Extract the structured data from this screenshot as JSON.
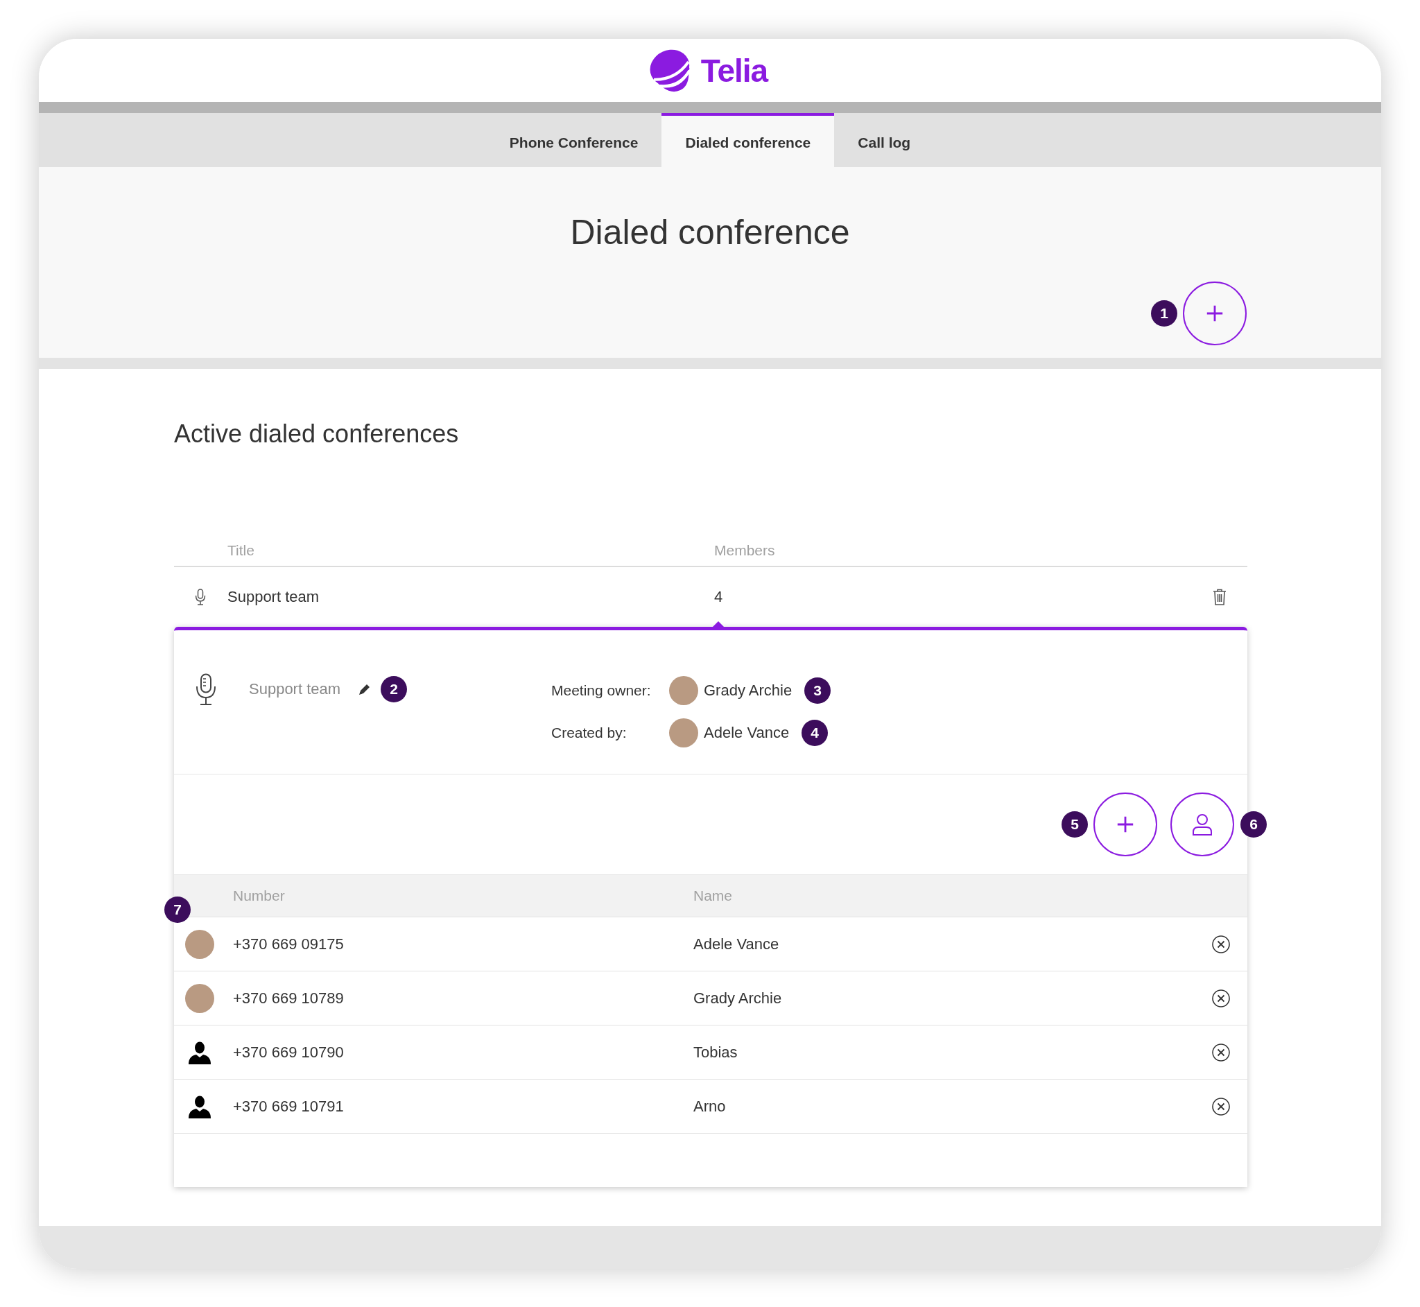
{
  "header": {
    "logo_text": "Telia"
  },
  "tabs": [
    {
      "label": "Phone Conference",
      "selected": false
    },
    {
      "label": "Dialed conference",
      "selected": true
    },
    {
      "label": "Call log",
      "selected": false
    }
  ],
  "page_title": "Dialed conference",
  "create_button": {
    "badge": "1"
  },
  "section_title": "Active dialed conferences",
  "conferences_table": {
    "columns": [
      "Title",
      "Members"
    ],
    "rows": [
      {
        "title": "Support team",
        "members": "4",
        "expanded": true
      }
    ]
  },
  "details": {
    "title": "Support team",
    "title_badge": "2",
    "meeting_owner": {
      "label": "Meeting owner:",
      "name": "Grady Archie",
      "badge": "3"
    },
    "created_by": {
      "label": "Created by:",
      "name": "Adele Vance",
      "badge": "4"
    },
    "add_member_badge": "5",
    "contacts_badge": "6",
    "members_badge": "7",
    "columns": [
      "Number",
      "Name"
    ],
    "members": [
      {
        "number": "+370 669 09175",
        "name": "Adele Vance",
        "kind": "photo"
      },
      {
        "number": "+370 669 10789",
        "name": "Grady Archie",
        "kind": "photo"
      },
      {
        "number": "+370 669 10790",
        "name": "Tobias",
        "kind": "silhouette"
      },
      {
        "number": "+370 669 10791",
        "name": "Arno",
        "kind": "silhouette"
      }
    ]
  }
}
